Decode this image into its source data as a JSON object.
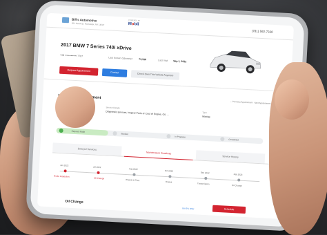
{
  "business": {
    "name": "Bill's Automotive",
    "address": "321 South St, Rochester, NY 14607",
    "phone": "(781) 592-7330"
  },
  "brand": {
    "small": "POWERED BY",
    "name_prefix": "M",
    "name_o": "o",
    "name_suffix": "bil"
  },
  "vehicle": {
    "title": "2017 BMW 7 Series 740i xDrive",
    "vin_label": "VIN",
    "vin": "•••••••••••••• 7787",
    "mileage_label": "Last Known Odometer",
    "mileage": "73,336",
    "last_visit_label": "Last Visit",
    "last_visit": "Sep 1, 2022"
  },
  "actions": {
    "request": "Request Appointment",
    "contact": "Contact",
    "check_alerts": "Check Own This Vehicle Anymore"
  },
  "appointment": {
    "title": "Upcoming Appointment",
    "nav_prev": "← Previous Appointment",
    "nav_next": "Next Appointment →",
    "date_label": "Start Date",
    "date_value": "Mon, Aug 1, 9:30 AM",
    "services_label": "Service Details",
    "services_value": "Diagnostic services, Inspect Parts or Cost of Engine, Oil, ...",
    "type_label": "Type",
    "type_value": "Waiting",
    "steps": [
      "Request Made",
      "Booked",
      "In Progress",
      "Completed"
    ],
    "progress": 0.25
  },
  "tabs": [
    "Delayed Services",
    "Maintenance Roadmap",
    "Service History"
  ],
  "roadmap": {
    "dates": [
      "Jun 2022",
      "Jul 2022",
      "Aug 2022",
      "Oct 2022",
      "Dec 2022",
      "Feb 2023"
    ],
    "items": [
      "Brake Inspection",
      "Oil Change",
      "Wheels & Tires",
      "Brakes",
      "Transmission",
      "Oil Change"
    ]
  },
  "oil_change": {
    "title": "Oil Change",
    "link": "Get 5% Offer",
    "button": "Schedule"
  },
  "colors": {
    "accent": "#d32430",
    "blue": "#2e7de0",
    "success": "#c9ebc2"
  }
}
